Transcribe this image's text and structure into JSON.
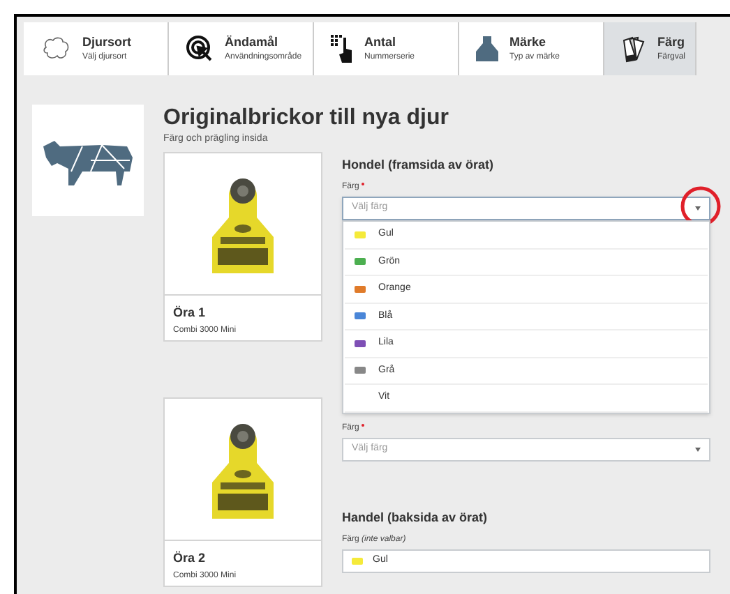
{
  "steps": [
    {
      "kind": "animal",
      "title": "Djursort",
      "subtitle": "Välj djursort",
      "selected": false
    },
    {
      "kind": "target",
      "title": "Ändamål",
      "subtitle": "Användningsområde",
      "selected": false
    },
    {
      "kind": "keypad",
      "title": "Antal",
      "subtitle": "Nummerserie",
      "selected": false
    },
    {
      "kind": "tag",
      "title": "Märke",
      "subtitle": "Typ av märke",
      "selected": false
    },
    {
      "kind": "swatches",
      "title": "Färg",
      "subtitle": "Färgval",
      "selected": true
    }
  ],
  "heading": {
    "title": "Originalbrickor till nya djur",
    "subtitle": "Färg och prägling insida"
  },
  "ears": [
    {
      "name": "Öra 1",
      "model": "Combi 3000 Mini",
      "sections": [
        {
          "title": "Hondel (framsida av örat)",
          "label": "Färg",
          "required": true,
          "placeholder": "Välj färg",
          "open": true
        }
      ]
    },
    {
      "name": "Öra 2",
      "model": "Combi 3000 Mini",
      "sections": [
        {
          "label": "Färg",
          "required": true,
          "placeholder": "Välj färg",
          "open": false
        },
        {
          "title": "Handel (baksida av örat)",
          "label": "Färg *(inte valbar)*",
          "value": "Gul",
          "color": "#f5ea3a"
        }
      ]
    }
  ],
  "dropdown_options": [
    {
      "label": "Gul",
      "color": "#f5ea3a"
    },
    {
      "label": "Grön",
      "color": "#4caf50"
    },
    {
      "label": "Orange",
      "color": "#e07b2a"
    },
    {
      "label": "Blå",
      "color": "#4a86d8"
    },
    {
      "label": "Lila",
      "color": "#7e4fb5"
    },
    {
      "label": "Grå",
      "color": "#888888"
    },
    {
      "label": "Vit"
    }
  ]
}
